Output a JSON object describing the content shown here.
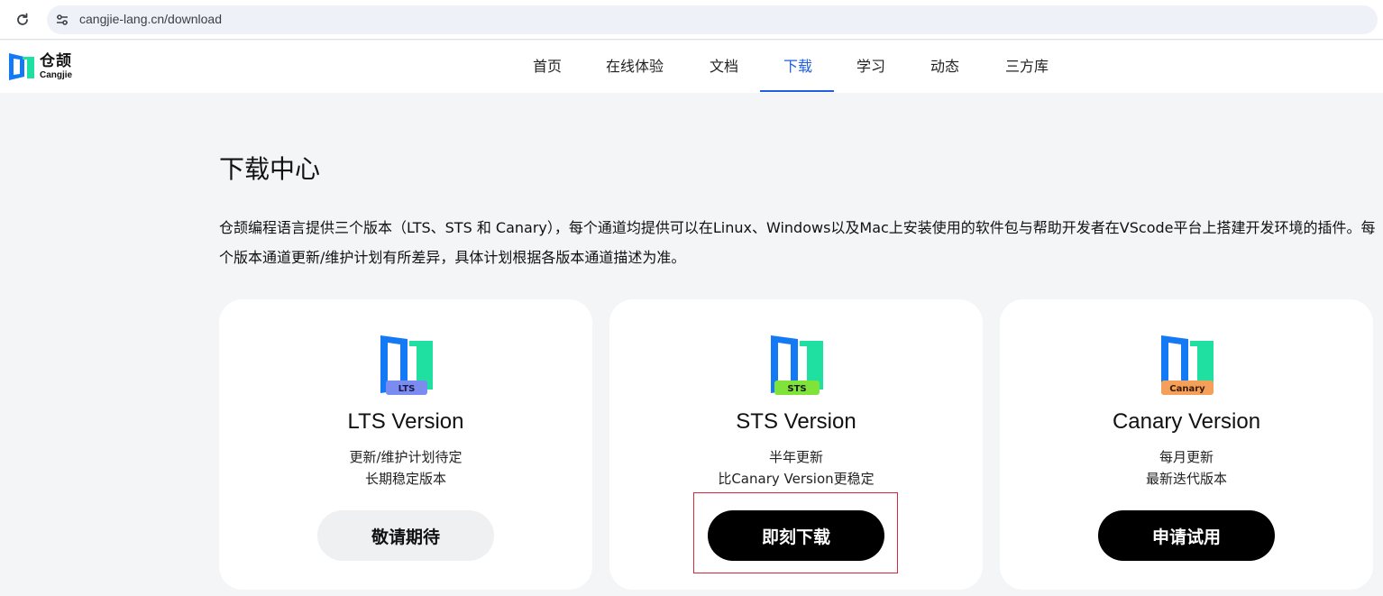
{
  "browser": {
    "url": "cangjie-lang.cn/download"
  },
  "header": {
    "logo": {
      "cn": "仓颉",
      "en": "Cangjie"
    },
    "nav": [
      {
        "label": "首页"
      },
      {
        "label": "在线体验"
      },
      {
        "label": "文档"
      },
      {
        "label": "下载",
        "active": true
      },
      {
        "label": "学习"
      },
      {
        "label": "动态"
      },
      {
        "label": "三方库"
      }
    ]
  },
  "main": {
    "title": "下载中心",
    "description": "仓颉编程语言提供三个版本（LTS、STS 和 Canary），每个通道均提供可以在Linux、Windows以及Mac上安装使用的软件包与帮助开发者在VScode平台上搭建开发环境的插件。每个版本通道更新/维护计划有所差异，具体计划根据各版本通道描述为准。",
    "cards": [
      {
        "badge": "LTS",
        "badge_color": "#7b8cf0",
        "title": "LTS Version",
        "line1": "更新/维护计划待定",
        "line2": "长期稳定版本",
        "button": "敬请期待",
        "button_style": "light"
      },
      {
        "badge": "STS",
        "badge_color": "#7fe33a",
        "title": "STS Version",
        "line1": "半年更新",
        "line2": "比Canary Version更稳定",
        "button": "即刻下载",
        "button_style": "dark"
      },
      {
        "badge": "Canary",
        "badge_color": "#f5a05a",
        "title": "Canary Version",
        "line1": "每月更新",
        "line2": "最新迭代版本",
        "button": "申请试用",
        "button_style": "dark"
      }
    ]
  },
  "colors": {
    "accent": "#1f5fe0",
    "logo_blue": "#1479f5",
    "logo_green": "#1fe0a0",
    "highlight": "#d6283a"
  }
}
